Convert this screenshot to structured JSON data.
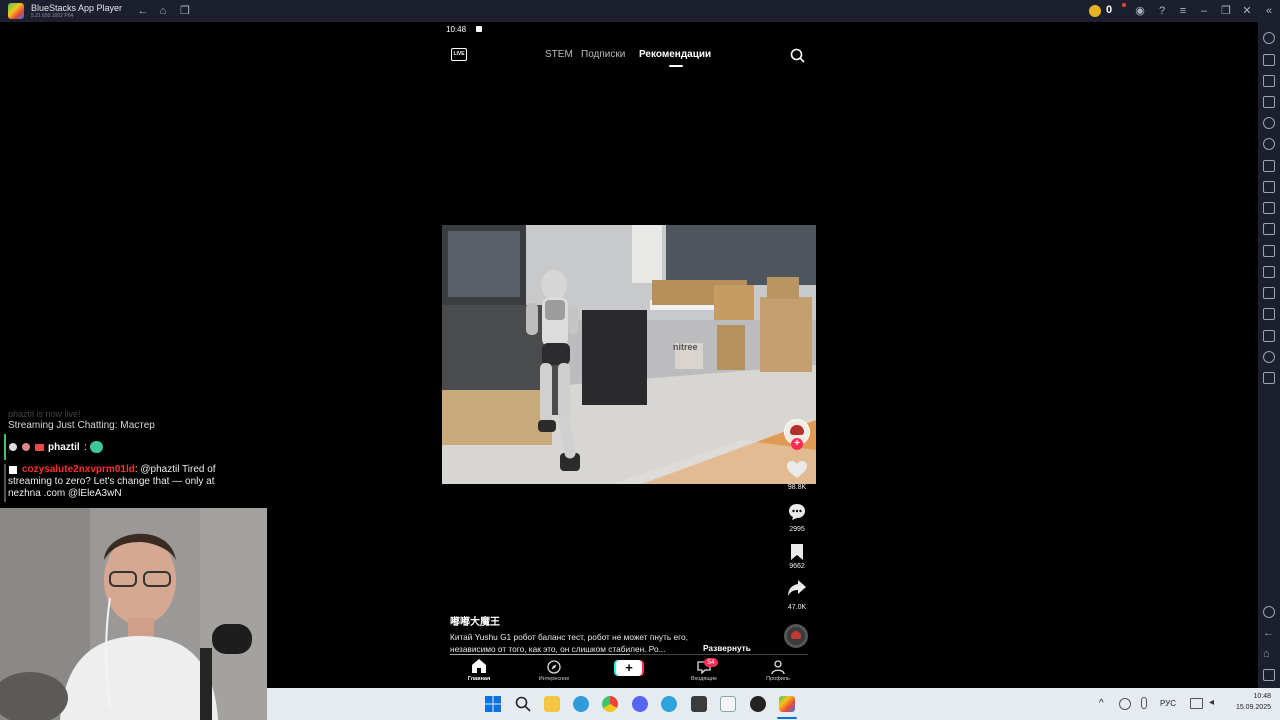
{
  "titlebar": {
    "app_name": "BlueStacks App Player",
    "version": "5.21.650.1002 P64",
    "coins": "0"
  },
  "phone": {
    "status_time": "10:48",
    "tabs": [
      "STEM",
      "Подписки",
      "Рекомендации"
    ],
    "active_tab": "Рекомендации",
    "video": {
      "author": "嘟嘟大魔王",
      "caption": "Китай Yushu G1 робот баланс тест, робот не может пнуть его, независимо от того, как это, он слишком стабилен. Ро...",
      "expand_label": "Развернуть",
      "likes": "98.8K",
      "comments": "2995",
      "saves": "9662",
      "shares": "47.0K",
      "sign_text": "nitree"
    },
    "bottom_nav": {
      "home": "Главная",
      "discover": "Интересное",
      "inbox": "Входящие",
      "inbox_badge": "54",
      "profile": "Профиль"
    }
  },
  "chat": {
    "line0": "phaztil is now live!",
    "line1": "Streaming Just Chatting: Мастер",
    "user1": "phaztil",
    "user2": "cozysalute2nxvprm01ld",
    "msg2": ": @phaztil Tired of streaming to zero? Let's change that — only at nezhna .com @lEleA3wN"
  },
  "taskbar": {
    "lang": "РУС",
    "time": "10:48",
    "date": "15.09.2025"
  }
}
